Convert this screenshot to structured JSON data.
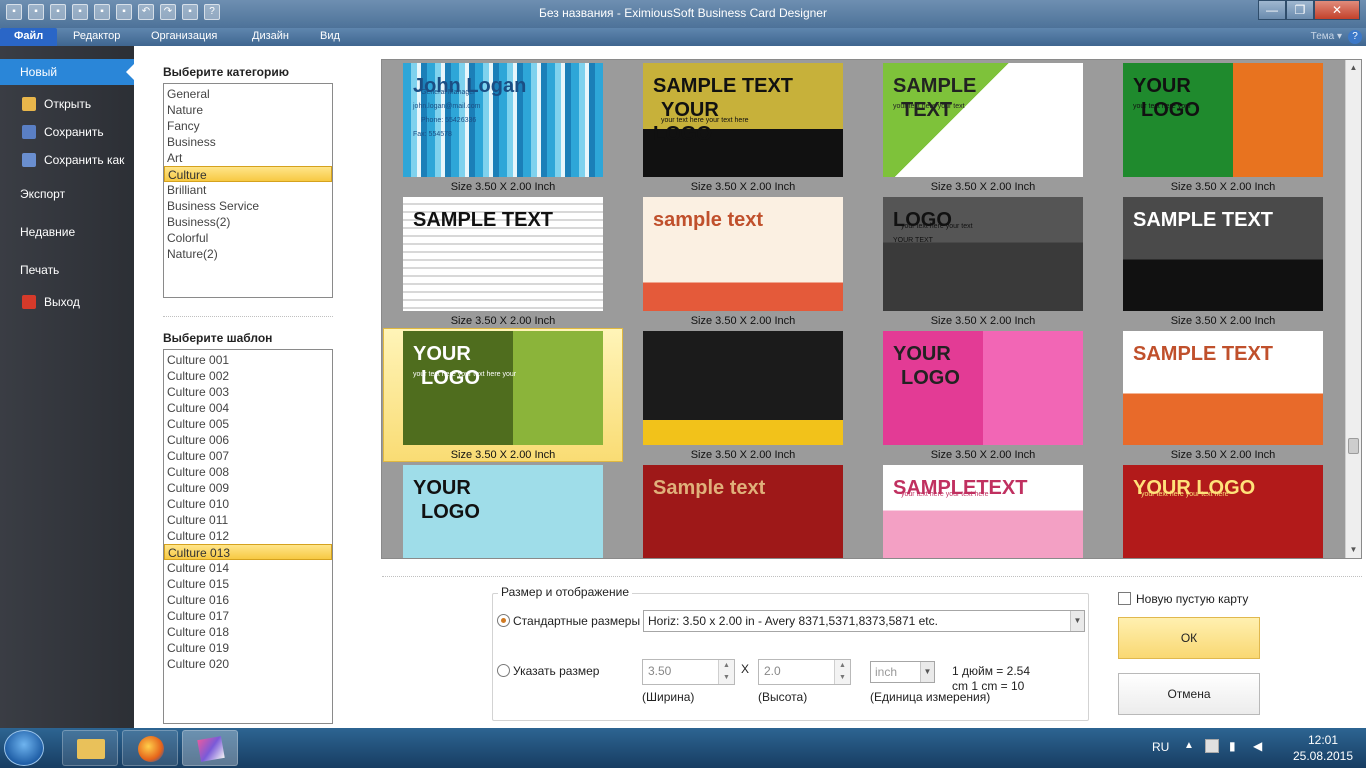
{
  "window": {
    "title": "Без названия - EximiousSoft Business Card Designer",
    "controls": {
      "minimize": "—",
      "maximize": "❐",
      "close": "✕"
    }
  },
  "menu": {
    "tabs": [
      "Файл",
      "Редактор",
      "Организация",
      "Дизайн",
      "Вид"
    ],
    "theme_label": "Тема ▾",
    "help_glyph": "?"
  },
  "left_nav": {
    "items": [
      {
        "label": "Новый",
        "icon": ""
      },
      {
        "label": "Открыть",
        "icon": "folder-icon"
      },
      {
        "label": "Сохранить",
        "icon": "save-icon"
      },
      {
        "label": "Сохранить как",
        "icon": "save-as-icon"
      },
      {
        "label": "Экспорт",
        "icon": ""
      },
      {
        "label": "Недавние",
        "icon": ""
      },
      {
        "label": "Печать",
        "icon": ""
      },
      {
        "label": "Выход",
        "icon": "exit-icon"
      }
    ],
    "colors": {
      "selected": "#2a86d8",
      "background": "#33363c"
    }
  },
  "category": {
    "title": "Выберите категорию",
    "items": [
      "General",
      "Nature",
      "Fancy",
      "Business",
      "Art",
      "Culture",
      "Brilliant",
      "Business Service",
      "Business(2)",
      "Colorful",
      "Nature(2)"
    ],
    "selected_index": 5
  },
  "template": {
    "title": "Выберите шаблон",
    "items": [
      "Culture 001",
      "Culture 002",
      "Culture 003",
      "Culture 004",
      "Culture 005",
      "Culture 006",
      "Culture 007",
      "Culture 008",
      "Culture 009",
      "Culture 010",
      "Culture 011",
      "Culture 012",
      "Culture 013",
      "Culture 014",
      "Culture 015",
      "Culture 016",
      "Culture 017",
      "Culture 018",
      "Culture 019",
      "Culture 020"
    ],
    "selected_index": 12
  },
  "gallery": {
    "caption": "Size 3.50 X 2.00 Inch",
    "selected_index": 8,
    "cards": [
      {
        "texts": [
          "John Logan",
          "General Manager",
          "john.logan@mail.com",
          "Phone: 55426336",
          "Fax: 554578"
        ]
      },
      {
        "texts": [
          "SAMPLE TEXT",
          "YOUR",
          "LOGO",
          "your text here your text here"
        ]
      },
      {
        "texts": [
          "SAMPLE",
          "TEXT",
          "your text here your text"
        ]
      },
      {
        "texts": [
          "YOUR",
          "LOGO",
          "your text here your"
        ]
      },
      {
        "texts": [
          "SAMPLE TEXT"
        ]
      },
      {
        "texts": [
          "sample text"
        ]
      },
      {
        "texts": [
          "LOGO",
          "your text here your text",
          "YOUR TEXT"
        ]
      },
      {
        "texts": [
          "SAMPLE TEXT"
        ]
      },
      {
        "texts": [
          "YOUR",
          "LOGO",
          "your text here your text here your"
        ]
      },
      {
        "texts": []
      },
      {
        "texts": [
          "YOUR",
          "LOGO"
        ]
      },
      {
        "texts": [
          "SAMPLE TEXT"
        ]
      },
      {
        "texts": [
          "YOUR",
          "LOGO"
        ]
      },
      {
        "texts": [
          "Sample text"
        ]
      },
      {
        "texts": [
          "SAMPLETEXT",
          "your text here your text here"
        ]
      },
      {
        "texts": [
          "YOUR LOGO",
          "your text here your text here"
        ]
      }
    ]
  },
  "size_group": {
    "title": "Размер и отображение",
    "standard_label": "Стандартные размеры",
    "standard_value": "Horiz: 3.50 x 2.00 in - Avery 8371,5371,8373,5871 etc.",
    "custom_label": "Указать размер",
    "width_value": "3.50",
    "height_value": "2.0",
    "times": "X",
    "unit_value": "inch",
    "width_caption": "(Ширина)",
    "height_caption": "(Высота)",
    "unit_caption": "(Единица измерения)",
    "conversion_line1": "1 дюйм = 2.54",
    "conversion_line2": "cm  1 cm = 10"
  },
  "actions": {
    "blank_card_label": "Новую пустую карту",
    "ok_label": "ОК",
    "cancel_label": "Отмена"
  },
  "taskbar": {
    "lang": "RU",
    "time": "12:01",
    "date": "25.08.2015"
  }
}
